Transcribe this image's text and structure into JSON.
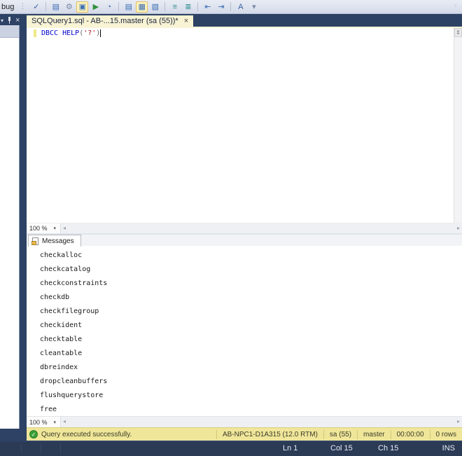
{
  "toolbar": {
    "debug_label": "bug",
    "grip_glyph": "⋮",
    "buttons": [
      {
        "name": "parse",
        "glyph": "✓",
        "highlighted": false
      },
      {
        "name": "display-estimated-execution-plan",
        "glyph": "▤",
        "highlighted": false
      },
      {
        "name": "query-options",
        "glyph": "⚙",
        "highlighted": false
      },
      {
        "name": "intellisense-enabled",
        "glyph": "▣",
        "highlighted": true
      },
      {
        "name": "include-actual-execution-plan",
        "glyph": "▶",
        "highlighted": false
      },
      {
        "name": "include-client-statistics",
        "glyph": "◔",
        "highlighted": false
      },
      {
        "name": "results-to-text",
        "glyph": "▤",
        "highlighted": false
      },
      {
        "name": "results-to-grid",
        "glyph": "▦",
        "highlighted": true
      },
      {
        "name": "results-to-file",
        "glyph": "▧",
        "highlighted": false
      },
      {
        "name": "comment-out-lines",
        "glyph": "≡",
        "highlighted": false
      },
      {
        "name": "uncomment-lines",
        "glyph": "≣",
        "highlighted": false
      },
      {
        "name": "decrease-indent",
        "glyph": "⇤",
        "highlighted": false
      },
      {
        "name": "increase-indent",
        "glyph": "⇥",
        "highlighted": false
      },
      {
        "name": "specify-template-parameters",
        "glyph": "A",
        "highlighted": false
      },
      {
        "name": "toolbar-options",
        "glyph": "▾",
        "highlighted": false
      }
    ]
  },
  "left_panel": {
    "dropdown_glyph": "▾",
    "close_glyph": "×"
  },
  "tab": {
    "title": "SQLQuery1.sql - AB-...15.master (sa (55))*",
    "close_glyph": "×",
    "overflow_glyph": "▾"
  },
  "editor": {
    "code": {
      "keyword": "DBCC HELP",
      "paren_open": "(",
      "string": "'?'",
      "paren_close": ")"
    },
    "zoom_top": "100 %",
    "zoom_bottom": "100 %",
    "splitter_glyph": "⇕"
  },
  "glyphs": {
    "dropdown": "▾",
    "scroll_left": "◂",
    "scroll_right": "▸",
    "check": "✓"
  },
  "messages": {
    "tab_label": "Messages",
    "items": [
      "checkalloc",
      "checkcatalog",
      "checkconstraints",
      "checkdb",
      "checkfilegroup",
      "checkident",
      "checktable",
      "cleantable",
      "dbreindex",
      "dropcleanbuffers",
      "flushquerystore",
      "free"
    ]
  },
  "query_status": {
    "message": "Query executed successfully.",
    "server": "AB-NPC1-D1A315 (12.0 RTM)",
    "user": "sa (55)",
    "database": "master",
    "elapsed": "00:00:00",
    "rows": "0 rows"
  },
  "bottom_bar": {
    "line": "Ln 1",
    "column": "Col 15",
    "character": "Ch 15",
    "mode": "INS"
  },
  "colors": {
    "window_chrome": "#2d4264",
    "toolbar_bg": "#dde3ef",
    "active_tab_bg": "#f8f3d3",
    "tab_underline": "#faf5d8",
    "editor_bg": "#ffffff",
    "keyword_blue": "#0000cc",
    "string_red": "#aa1111",
    "modified_line_yellow": "#f0e98c",
    "status_bar_yellow": "#efe69a",
    "success_green": "#3aa136",
    "bottom_bar_navy": "#2b3a55"
  }
}
